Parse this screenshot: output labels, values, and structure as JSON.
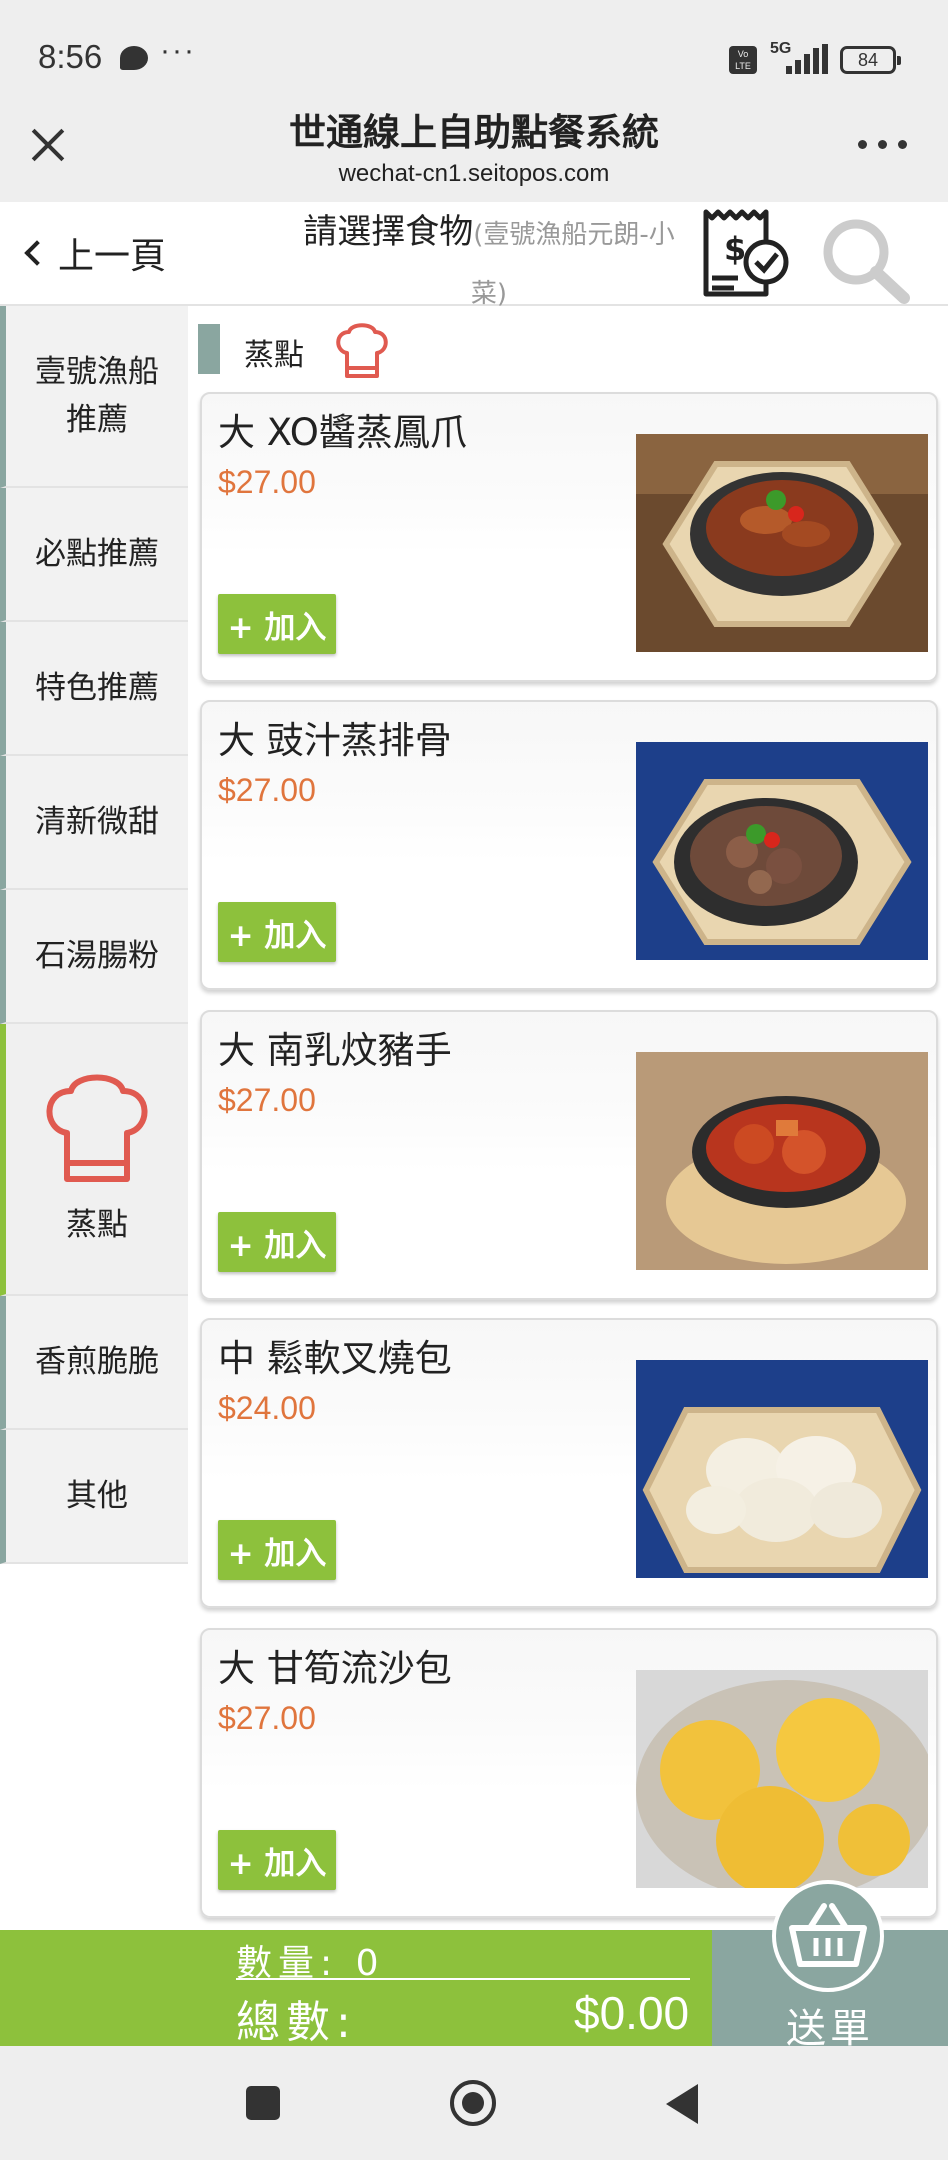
{
  "status_bar": {
    "time": "8:56",
    "network": "5G",
    "volte": "Vo LTE",
    "battery": "84"
  },
  "header": {
    "title": "世通線上自助點餐系統",
    "url": "wechat-cn1.seitopos.com"
  },
  "subheader": {
    "back_label": "上一頁",
    "title": "請選擇食物",
    "subtitle": "(壹號漁船元朗-小菜)"
  },
  "sidebar": {
    "items": [
      {
        "label": "壹號漁船推薦",
        "line1": "壹號漁船",
        "line2": "推薦"
      },
      {
        "label": "必點推薦"
      },
      {
        "label": "特色推薦"
      },
      {
        "label": "清新微甜"
      },
      {
        "label": "石湯腸粉"
      },
      {
        "label": "蒸點",
        "active": true
      },
      {
        "label": "香煎脆脆"
      },
      {
        "label": "其他"
      }
    ]
  },
  "section": {
    "title": "蒸點"
  },
  "items": [
    {
      "name": "大 XO醬蒸鳳爪",
      "price": "$27.00",
      "add_label": "+ 加入"
    },
    {
      "name": "大 豉汁蒸排骨",
      "price": "$27.00",
      "add_label": "+ 加入"
    },
    {
      "name": "大 南乳炆豬手",
      "price": "$27.00",
      "add_label": "+ 加入"
    },
    {
      "name": "中 鬆軟叉燒包",
      "price": "$24.00",
      "add_label": "+ 加入"
    },
    {
      "name": "大 甘筍流沙包",
      "price": "$27.00",
      "add_label": "+ 加入"
    }
  ],
  "footer": {
    "qty_label": "數量:",
    "qty_value": "0",
    "total_label": "總數:",
    "total_value": "$0.00",
    "send_label": "送單"
  },
  "colors": {
    "accent_green": "#8dc13c",
    "accent_gray": "#8aa6a0",
    "price": "#e0753d",
    "chef_icon": "#e05a50"
  }
}
